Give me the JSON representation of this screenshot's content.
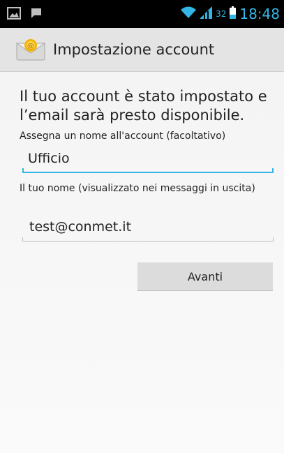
{
  "status_bar": {
    "icons": [
      "image-icon",
      "chat-icon"
    ],
    "battery_percent": "32",
    "time": "18:48",
    "accent_color": "#33b5e5"
  },
  "action_bar": {
    "title": "Impostazione account",
    "icon": "email-app-icon"
  },
  "main": {
    "headline": "Il tuo account è stato impostato e l’email sarà presto disponibile.",
    "account_name_label": "Assegna un nome all'account (facoltativo)",
    "account_name_value": "Ufficio",
    "your_name_label": "Il tuo nome (visualizzato nei messaggi in uscita)",
    "your_name_value": "test@conmet.it",
    "next_button_label": "Avanti"
  }
}
